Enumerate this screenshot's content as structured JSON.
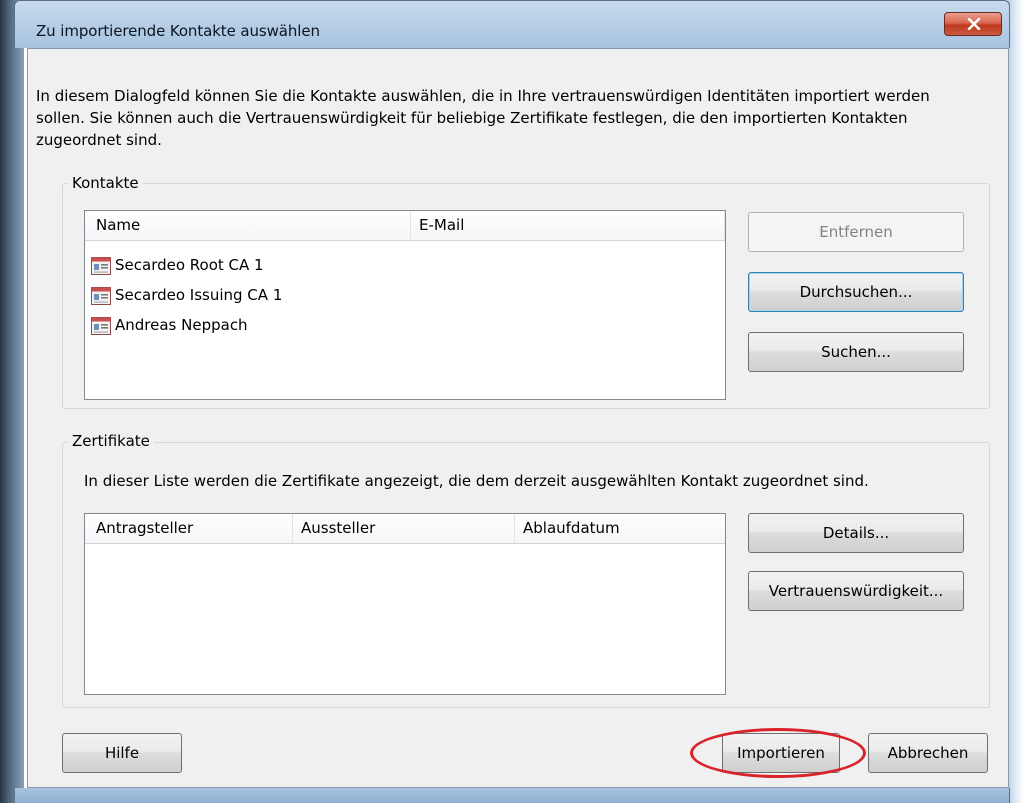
{
  "window": {
    "title": "Zu importierende Kontakte auswählen",
    "close_glyph": "x"
  },
  "intro_text": "In diesem Dialogfeld können Sie die Kontakte auswählen, die in Ihre vertrauenswürdigen Identitäten importiert werden sollen. Sie können auch die Vertrauenswürdigkeit für beliebige Zertifikate festlegen, die den importierten Kontakten zugeordnet sind.",
  "contacts": {
    "group_title": "Kontakte",
    "columns": [
      "Name",
      "E-Mail"
    ],
    "rows": [
      {
        "name": "Secardeo Root CA 1",
        "email": "",
        "icon": "contact-card-icon"
      },
      {
        "name": "Secardeo Issuing CA 1",
        "email": "",
        "icon": "contact-card-icon"
      },
      {
        "name": "Andreas Neppach",
        "email": "",
        "icon": "contact-card-icon"
      }
    ],
    "buttons": {
      "remove": "Entfernen",
      "browse": "Durchsuchen...",
      "search": "Suchen..."
    }
  },
  "certificates": {
    "group_title": "Zertifikate",
    "description": "In dieser Liste werden die Zertifikate angezeigt, die dem derzeit ausgewählten Kontakt zugeordnet sind.",
    "columns": [
      "Antragsteller",
      "Aussteller",
      "Ablaufdatum"
    ],
    "buttons": {
      "details": "Details...",
      "trust": "Vertrauenswürdigkeit..."
    }
  },
  "footer": {
    "help": "Hilfe",
    "import": "Importieren",
    "cancel": "Abbrechen"
  },
  "colors": {
    "highlight_ring": "#d8232a",
    "close_button": "#c0391f"
  }
}
